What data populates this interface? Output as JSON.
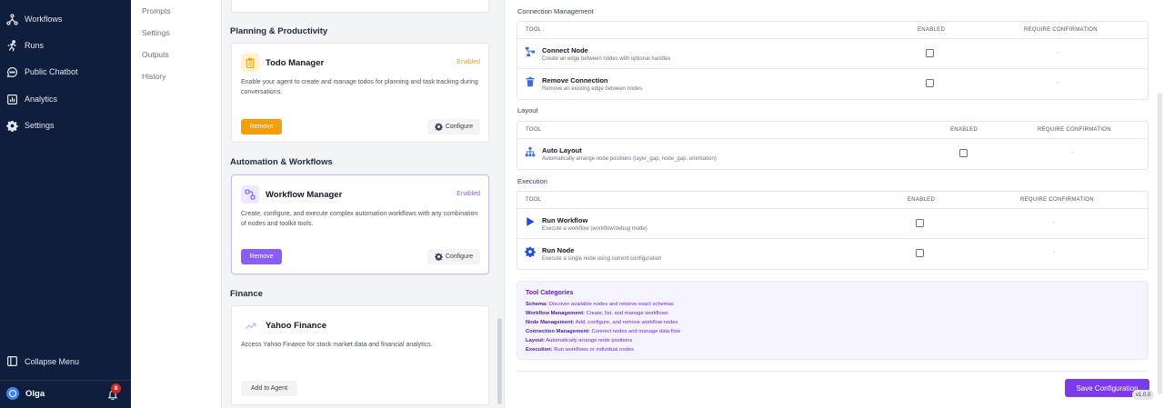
{
  "sidebar": {
    "items": [
      {
        "label": "Workflows",
        "icon": "workflow-icon"
      },
      {
        "label": "Runs",
        "icon": "running-person-icon"
      },
      {
        "label": "Public Chatbot",
        "icon": "chat-bubble-icon"
      },
      {
        "label": "Analytics",
        "icon": "bar-chart-icon"
      },
      {
        "label": "Settings",
        "icon": "gear-icon"
      }
    ],
    "collapse_label": "Collapse Menu",
    "user_name": "Olga",
    "notification_count": "8"
  },
  "submenu": {
    "items": [
      "Prompts",
      "Settings",
      "Outputs",
      "History"
    ]
  },
  "middle": {
    "sections": {
      "planning": "Planning & Productivity",
      "automation": "Automation & Workflows",
      "finance": "Finance"
    },
    "cards": {
      "todo": {
        "title": "Todo Manager",
        "status": "Enabled",
        "description": "Enable your agent to create and manage todos for planning and task tracking during conversations.",
        "remove_label": "Remove",
        "configure_label": "Configure"
      },
      "workflow": {
        "title": "Workflow Manager",
        "status": "Enabled",
        "description": "Create, configure, and execute complex automation workflows with any combination of nodes and toolkit tools.",
        "remove_label": "Remove",
        "configure_label": "Configure"
      },
      "yahoo": {
        "title": "Yahoo Finance",
        "description": "Access Yahoo Finance for stock market data and financial analytics.",
        "add_label": "Add to Agent"
      }
    },
    "colors": {
      "orange": "#f59e0b",
      "purple": "#8b5cf6"
    }
  },
  "right": {
    "headers": {
      "tool": "TOOL",
      "enabled": "ENABLED",
      "require": "REQUIRE CONFIRMATION"
    },
    "groups": {
      "connection": {
        "label": "Connection Management",
        "tools": [
          {
            "name": "Connect Node",
            "description": "Create an edge between nodes with optional handles",
            "icon": "network-icon",
            "require": "-"
          },
          {
            "name": "Remove Connection",
            "description": "Remove an existing edge between nodes",
            "icon": "trash-icon",
            "require": "-"
          }
        ]
      },
      "layout": {
        "label": "Layout",
        "tools": [
          {
            "name": "Auto Layout",
            "description": "Automatically arrange node positions (layer_gap, node_gap, orientation)",
            "icon": "hierarchy-icon",
            "require": "-"
          }
        ]
      },
      "execution": {
        "label": "Execution",
        "tools": [
          {
            "name": "Run Workflow",
            "description": "Execute a workflow (workflow/debug mode)",
            "icon": "play-icon",
            "require": "-"
          },
          {
            "name": "Run Node",
            "description": "Execute a single node using current configuration",
            "icon": "gear-icon",
            "require": "-"
          }
        ]
      }
    },
    "categories": {
      "title": "Tool Categories",
      "lines": [
        {
          "term": "Schema:",
          "text": " Discover available nodes and retrieve exact schemas"
        },
        {
          "term": "Workflow Management:",
          "text": " Create, list, and manage workflows"
        },
        {
          "term": "Node Management:",
          "text": " Add, configure, and remove workflow nodes"
        },
        {
          "term": "Connection Management:",
          "text": " Connect nodes and manage data flow"
        },
        {
          "term": "Layout:",
          "text": " Automatically arrange node positions"
        },
        {
          "term": "Execution:",
          "text": " Run workflows or individual nodes"
        }
      ]
    },
    "save_label": "Save Configuration",
    "version": "v1.0.0"
  }
}
